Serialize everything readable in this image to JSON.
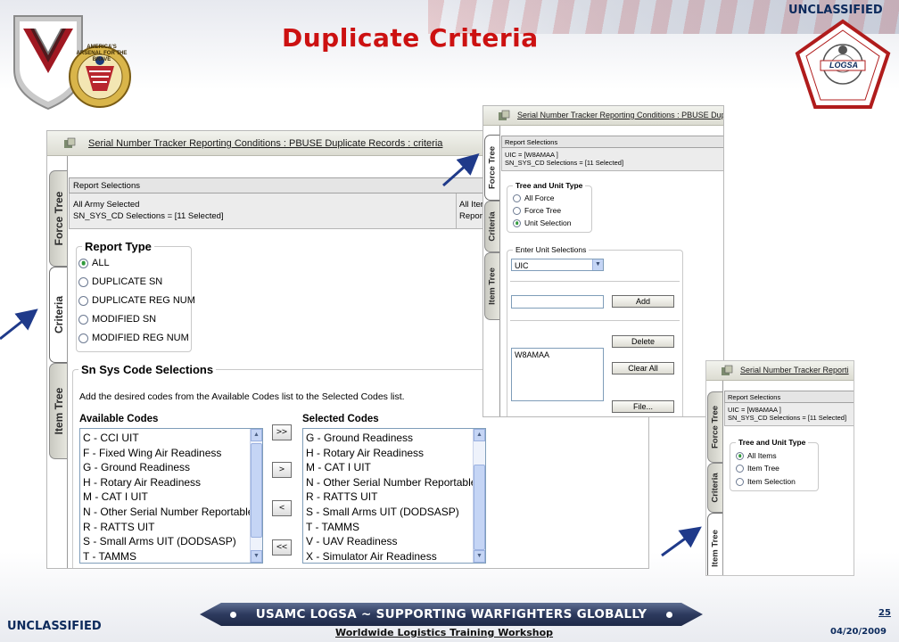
{
  "slide": {
    "classification_top": "UNCLASSIFIED",
    "classification_bottom": "UNCLASSIFIED",
    "title": "Duplicate Criteria",
    "page_number": "25",
    "date": "04/20/2009",
    "banner_text": "USAMC LOGSA ~ SUPPORTING WARFIGHTERS GLOBALLY",
    "workshop_text": "Worldwide Logistics Training Workshop",
    "left_logo_text": "AMERICA'S ARSENAL FOR THE BRAVE",
    "right_logo_text": "LOGSA",
    "colors": {
      "title_red": "#cc1111",
      "navy": "#0c2a5c",
      "arrow_blue": "#1f3a8a",
      "radio_green": "#2f9a3a"
    }
  },
  "main_window": {
    "title": "Serial Number Tracker Reporting Conditions : PBUSE Duplicate Records : criteria",
    "tabs": [
      {
        "label": "Force Tree",
        "active": false
      },
      {
        "label": "Criteria",
        "active": true
      },
      {
        "label": "Item Tree",
        "active": false
      }
    ],
    "report_selections": {
      "header": "Report Selections",
      "lines": [
        "All Army Selected",
        "SN_SYS_CD Selections = [11 Selected]"
      ],
      "right_lines": [
        "All Iter",
        "Report"
      ]
    },
    "report_type": {
      "legend": "Report Type",
      "options": [
        {
          "label": "ALL",
          "selected": true
        },
        {
          "label": "DUPLICATE SN",
          "selected": false
        },
        {
          "label": "DUPLICATE REG NUM",
          "selected": false
        },
        {
          "label": "MODIFIED SN",
          "selected": false
        },
        {
          "label": "MODIFIED REG NUM",
          "selected": false
        }
      ]
    },
    "sn_sys_code": {
      "legend": "Sn Sys Code Selections",
      "instructions": "Add the desired codes from the Available Codes list to the Selected Codes list.",
      "available_header": "Available Codes",
      "selected_header": "Selected Codes",
      "available": [
        "C - CCI UIT",
        "F - Fixed Wing Air Readiness",
        "G - Ground Readiness",
        "H - Rotary Air Readiness",
        "M - CAT I UIT",
        "N - Other Serial Number Reportable",
        "R - RATTS UIT",
        "S - Small Arms UIT (DODSASP)",
        "T - TAMMS"
      ],
      "selected": [
        "G - Ground Readiness",
        "H - Rotary Air Readiness",
        "M - CAT I UIT",
        "N - Other Serial Number Reportable",
        "R - RATTS UIT",
        "S - Small Arms UIT (DODSASP)",
        "T - TAMMS",
        "V - UAV Readiness",
        "X - Simulator Air Readiness"
      ],
      "move_buttons": [
        ">>",
        ">",
        "<",
        "<<"
      ]
    }
  },
  "force_window": {
    "title": "Serial Number Tracker Reporting Conditions : PBUSE Dupli",
    "tabs": [
      {
        "label": "Force Tree",
        "active": true
      },
      {
        "label": "Criteria",
        "active": false
      },
      {
        "label": "Item Tree",
        "active": false
      }
    ],
    "report_selections": {
      "header": "Report Selections",
      "lines": [
        "UIC = [W8AMAA ]",
        "SN_SYS_CD Selections = [11 Selected]"
      ]
    },
    "tree_unit_type": {
      "legend": "Tree and Unit Type",
      "options": [
        {
          "label": "All Force",
          "selected": false
        },
        {
          "label": "Force Tree",
          "selected": false
        },
        {
          "label": "Unit Selection",
          "selected": true
        }
      ]
    },
    "unit_selections": {
      "legend": "Enter Unit Selections",
      "dropdown_value": "UIC",
      "input_value": "",
      "add_label": "Add",
      "delete_label": "Delete",
      "clear_label": "Clear All",
      "file_label": "File...",
      "list_items": [
        "W8AMAA"
      ]
    }
  },
  "item_window": {
    "title": "Serial Number Tracker Reporti",
    "tabs": [
      {
        "label": "Force Tree",
        "active": false
      },
      {
        "label": "Criteria",
        "active": false
      },
      {
        "label": "Item Tree",
        "active": true
      }
    ],
    "report_selections": {
      "header": "Report Selections",
      "lines": [
        "UIC = [W8AMAA ]",
        "SN_SYS_CD Selections = [11 Selected]"
      ]
    },
    "tree_unit_type": {
      "legend": "Tree and Unit Type",
      "options": [
        {
          "label": "All Items",
          "selected": true
        },
        {
          "label": "Item Tree",
          "selected": false
        },
        {
          "label": "Item Selection",
          "selected": false
        }
      ]
    }
  }
}
